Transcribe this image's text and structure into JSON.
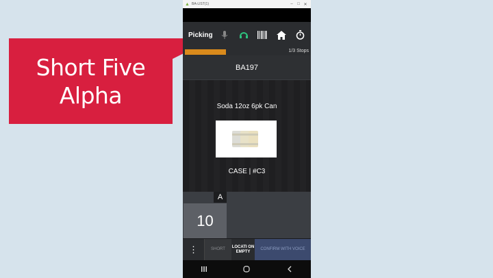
{
  "callout": {
    "line1": "Short Five",
    "line2": "Alpha"
  },
  "window": {
    "title": "BA-LIST(1)"
  },
  "appbar": {
    "title": "Picking"
  },
  "progress": {
    "fraction": 0.33,
    "text": "1/3 Stops"
  },
  "location": {
    "code": "BA197"
  },
  "item": {
    "description": "Soda 12oz 6pk Can",
    "uom": "CASE | #C3"
  },
  "quantity": {
    "value": "10",
    "badge": "A"
  },
  "actions": {
    "more": "⋮",
    "short": "SHORT",
    "location_empty": "LOCATI ON EMPTY",
    "confirm_voice": "CONFIRM WITH VOICE"
  },
  "colors": {
    "callout": "#d81f3f",
    "progress": "#d98a1c",
    "headset": "#2ec27e"
  }
}
